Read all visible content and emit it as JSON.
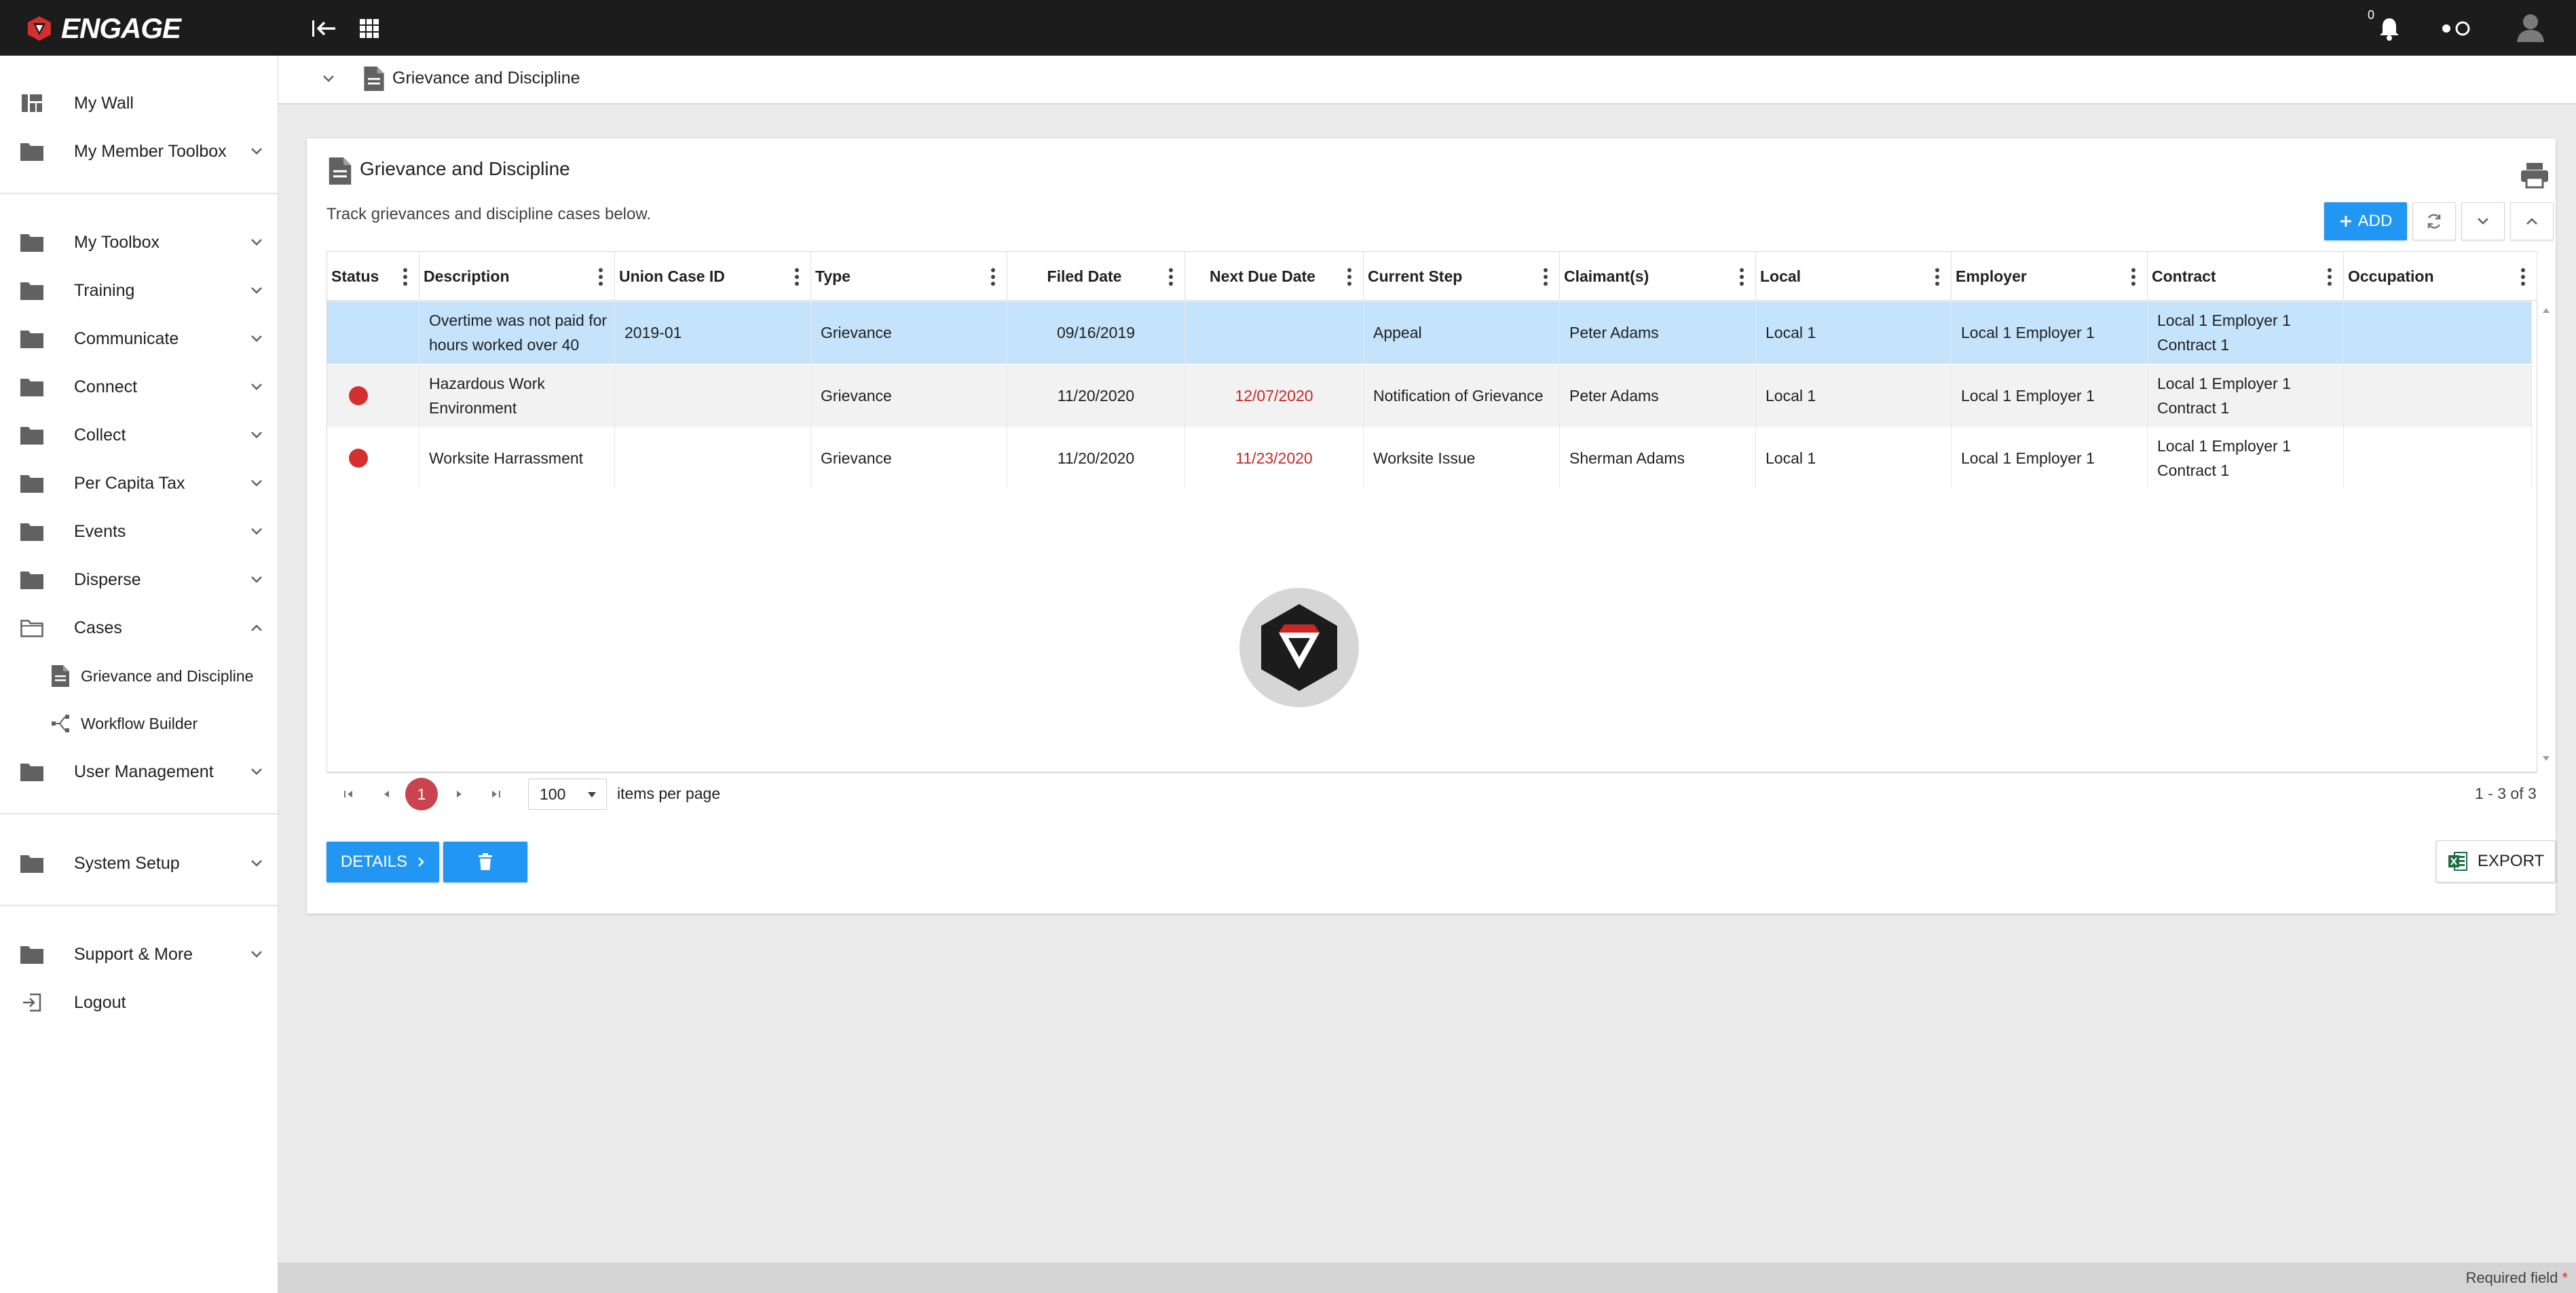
{
  "app": {
    "name": "ENGAGE",
    "brand_color": "#d32f2f",
    "topbar_color": "#1c1c1c",
    "accent": "#2196f3"
  },
  "topbar": {
    "notifications_count": "0"
  },
  "sidebar": {
    "items": [
      {
        "label": "My Wall",
        "icon": "dashboard-icon"
      },
      {
        "label": "My Member Toolbox",
        "icon": "folder-icon"
      },
      {
        "label": "My Toolbox",
        "icon": "folder-icon"
      },
      {
        "label": "Training",
        "icon": "folder-icon"
      },
      {
        "label": "Communicate",
        "icon": "folder-icon"
      },
      {
        "label": "Connect",
        "icon": "folder-icon"
      },
      {
        "label": "Collect",
        "icon": "folder-icon"
      },
      {
        "label": "Per Capita Tax",
        "icon": "folder-icon"
      },
      {
        "label": "Events",
        "icon": "folder-icon"
      },
      {
        "label": "Disperse",
        "icon": "folder-icon"
      },
      {
        "label": "Cases",
        "icon": "folder-open-icon"
      },
      {
        "label": "Grievance and Discipline",
        "icon": "document-icon"
      },
      {
        "label": "Workflow Builder",
        "icon": "workflow-icon"
      },
      {
        "label": "User Management",
        "icon": "folder-icon"
      },
      {
        "label": "System Setup",
        "icon": "folder-icon"
      },
      {
        "label": "Support & More",
        "icon": "folder-icon"
      },
      {
        "label": "Logout",
        "icon": "logout-icon"
      }
    ],
    "cut_label": "...."
  },
  "breadcrumb": {
    "current": "Grievance and Discipline"
  },
  "panel": {
    "title": "Grievance and Discipline",
    "description": "Track grievances and discipline cases below.",
    "add_label": "ADD"
  },
  "grid": {
    "columns": [
      "Status",
      "Description",
      "Union Case ID",
      "Type",
      "Filed Date",
      "Next Due Date",
      "Current Step",
      "Claimant(s)",
      "Local",
      "Employer",
      "Contract",
      "Occupation"
    ],
    "rows": [
      {
        "status": "",
        "description": "Overtime was not paid for hours worked over 40",
        "case_id": "2019-01",
        "type": "Grievance",
        "filed": "09/16/2019",
        "due": "",
        "step": "Appeal",
        "claimant": "Peter Adams",
        "local": "Local 1",
        "employer": "Local 1 Employer 1",
        "contract": "Local 1 Employer 1 Contract 1",
        "occupation": ""
      },
      {
        "status": "overdue",
        "description": "Hazardous Work Environment",
        "case_id": "",
        "type": "Grievance",
        "filed": "11/20/2020",
        "due": "12/07/2020",
        "step": "Notification of Grievance",
        "claimant": "Peter Adams",
        "local": "Local 1",
        "employer": "Local 1 Employer 1",
        "contract": "Local 1 Employer 1 Contract 1",
        "occupation": ""
      },
      {
        "status": "overdue",
        "description": "Worksite Harrassment",
        "case_id": "",
        "type": "Grievance",
        "filed": "11/20/2020",
        "due": "11/23/2020",
        "step": "Worksite Issue",
        "claimant": "Sherman Adams",
        "local": "Local 1",
        "employer": "Local 1 Employer 1",
        "contract": "Local 1 Employer 1 Contract 1",
        "occupation": ""
      }
    ],
    "selected_color": "#c5e3fa",
    "overdue_color": "#d32f2f"
  },
  "pager": {
    "current_page": "1",
    "page_size": "100",
    "items_label": "items per page",
    "info": "1 - 3 of 3"
  },
  "actions": {
    "details_label": "DETAILS",
    "export_label": "EXPORT"
  },
  "footer": {
    "required_label": "Required field",
    "required_mark": "*"
  }
}
